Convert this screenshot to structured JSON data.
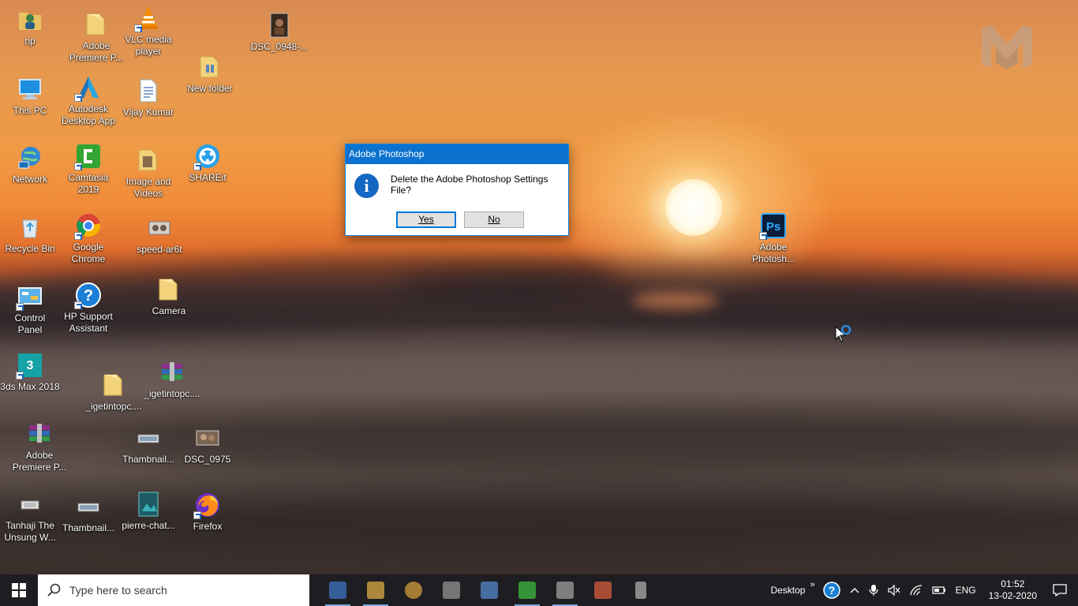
{
  "dialog": {
    "title": "Adobe Photoshop",
    "message": "Delete the Adobe Photoshop Settings File?",
    "yes_label": "Yes",
    "no_label": "No"
  },
  "desktop_icons": [
    {
      "label": "hp",
      "icon": "user-folder-icon"
    },
    {
      "label": "Adobe\nPremiere P...",
      "icon": "folder-icon"
    },
    {
      "label": "VLC media\nplayer",
      "icon": "vlc-icon"
    },
    {
      "label": "DSC_0948-...",
      "icon": "photo-icon"
    },
    {
      "label": "This PC",
      "icon": "computer-icon"
    },
    {
      "label": "Autodesk\nDesktop App",
      "icon": "autodesk-icon"
    },
    {
      "label": "Vijay Kumar",
      "icon": "document-icon"
    },
    {
      "label": "New folder",
      "icon": "folder-icon"
    },
    {
      "label": "Network",
      "icon": "network-icon"
    },
    {
      "label": "Camtasia\n2019",
      "icon": "camtasia-icon"
    },
    {
      "label": "Image and\nVideos",
      "icon": "folder-icon"
    },
    {
      "label": "SHAREit",
      "icon": "shareit-icon"
    },
    {
      "label": "Recycle Bin",
      "icon": "recycle-bin-icon"
    },
    {
      "label": "Google\nChrome",
      "icon": "chrome-icon"
    },
    {
      "label": "speed-ar6t",
      "icon": "media-icon"
    },
    {
      "label": "Control\nPanel",
      "icon": "control-panel-icon"
    },
    {
      "label": "HP Support\nAssistant",
      "icon": "help-icon"
    },
    {
      "label": "Camera",
      "icon": "folder-icon"
    },
    {
      "label": "3ds Max 2018",
      "icon": "3dsmax-icon"
    },
    {
      "label": "_igetintopc....",
      "icon": "folder-icon"
    },
    {
      "label": "_igetintopc....",
      "icon": "archive-icon"
    },
    {
      "label": "Adobe\nPremiere P...",
      "icon": "archive-icon"
    },
    {
      "label": "Thambnail...",
      "icon": "image-icon"
    },
    {
      "label": "DSC_0975",
      "icon": "photo-icon"
    },
    {
      "label": "Tanhaji The\nUnsung W...",
      "icon": "video-icon"
    },
    {
      "label": "Thambnail...",
      "icon": "image-icon"
    },
    {
      "label": "pierre-chat...",
      "icon": "image-icon"
    },
    {
      "label": "Firefox",
      "icon": "firefox-icon"
    },
    {
      "label": "Adobe\nPhotosh...",
      "icon": "photoshop-icon"
    }
  ],
  "taskbar": {
    "search_placeholder": "Type here to search",
    "desktop_label": "Desktop",
    "more_label": "»",
    "language": "ENG",
    "time": "01:52",
    "date": "13-02-2020",
    "apps": [
      {
        "icon": "app-icon",
        "color": "#3f78c9"
      },
      {
        "icon": "file-explorer-icon",
        "color": "#e8b548"
      },
      {
        "icon": "chrome-icon",
        "color": "#e0a33a"
      },
      {
        "icon": "app-icon",
        "color": "#9a9a9a"
      },
      {
        "icon": "app-icon",
        "color": "#5a8fd6"
      },
      {
        "icon": "camtasia-icon",
        "color": "#3caf3c"
      },
      {
        "icon": "app-icon",
        "color": "#a7a7a7"
      },
      {
        "icon": "app-icon",
        "color": "#e2603e"
      },
      {
        "icon": "app-icon",
        "color": "#cfcfcf"
      }
    ]
  }
}
